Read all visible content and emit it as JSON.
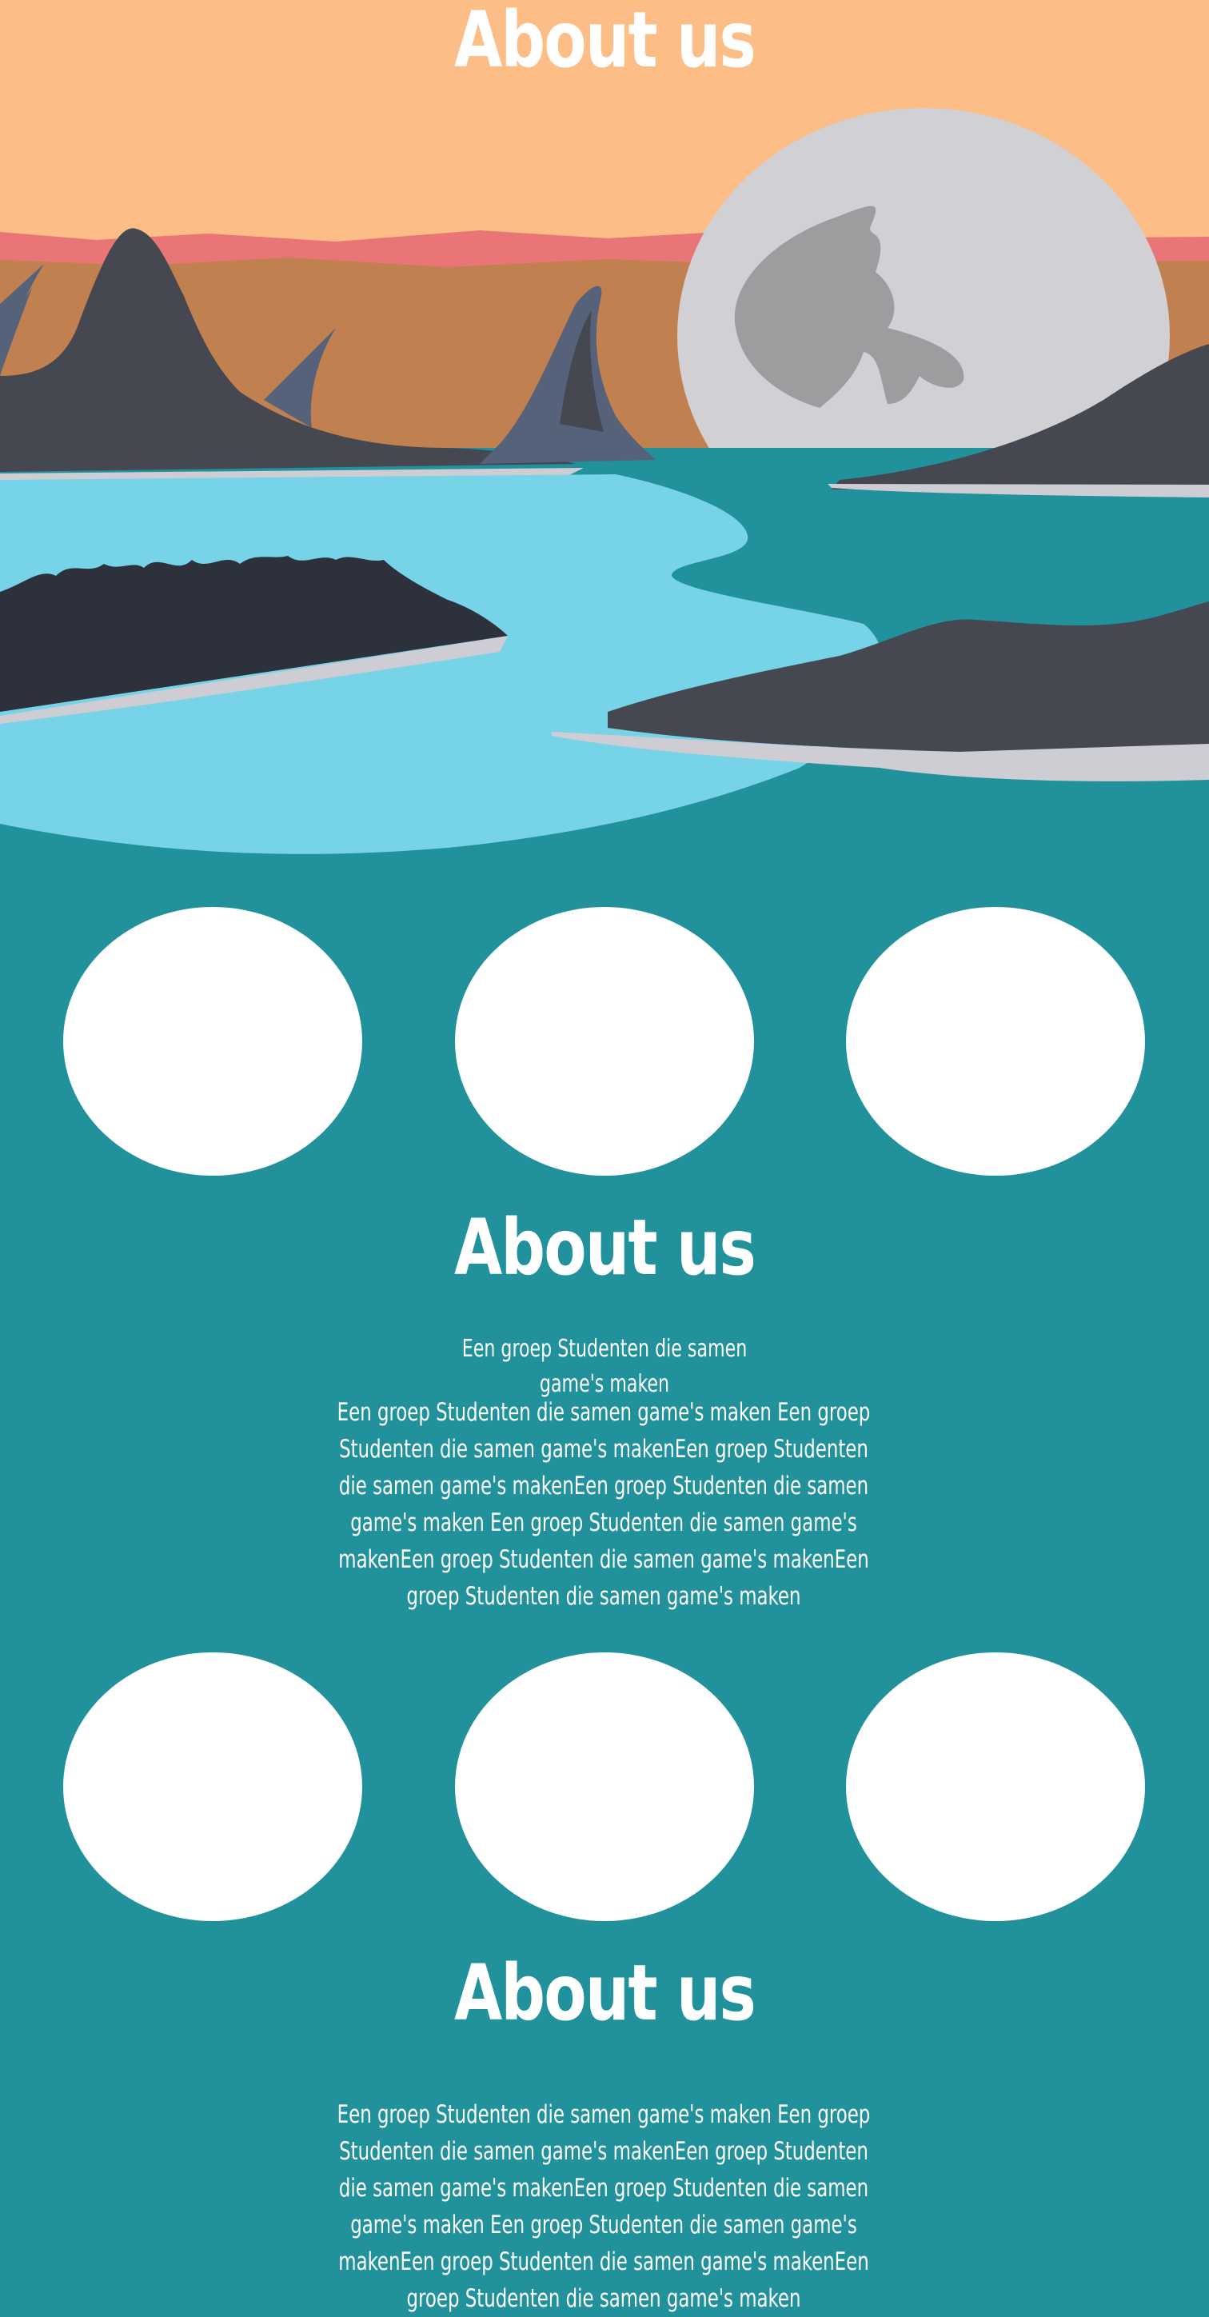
{
  "hero": {
    "title": "About us"
  },
  "sections": [
    {
      "title": "About us",
      "tagline": "Een groep Studenten die samen game's maken",
      "body": "Een groep Studenten die samen game's maken Een groep Studenten die samen game's makenEen groep Studenten die samen game's makenEen groep Studenten die samen game's maken Een groep Studenten die samen game's makenEen groep Studenten die samen game's makenEen groep Studenten die samen game's maken"
    },
    {
      "title": "About us",
      "body": "Een groep Studenten die samen game's maken Een groep Studenten die samen game's makenEen groep Studenten die samen game's makenEen groep Studenten die samen game's maken Een groep Studenten die samen game's makenEen groep Studenten die samen game's makenEen groep Studenten die samen game's maken"
    }
  ],
  "colors": {
    "sky": "#fdbd87",
    "horizon_pink": "#ea7577",
    "desert": "#c0804f",
    "mountain_dark": "#454751",
    "mountain_blue": "#55627a",
    "moon": "#d0d0d5",
    "moon_crater": "#9c9d9f",
    "lake_light": "#76d3e8",
    "sea_teal": "#21919c",
    "shore": "#cdcdd3",
    "circle": "#ffffff"
  }
}
